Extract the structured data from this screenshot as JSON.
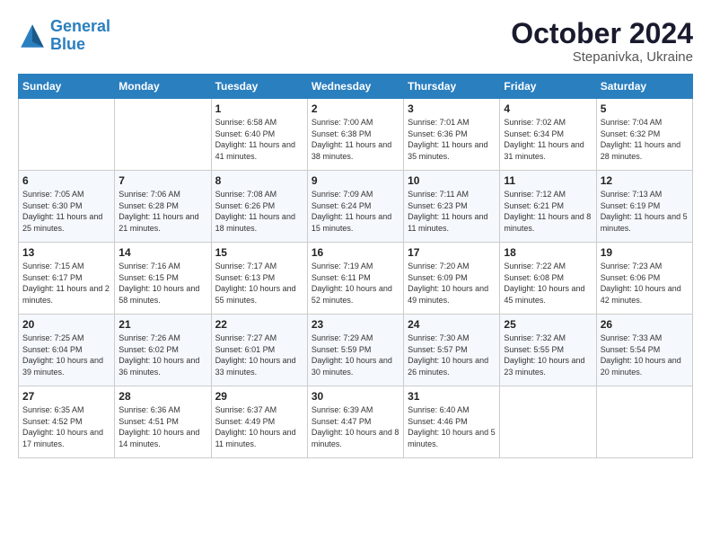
{
  "header": {
    "logo_line1": "General",
    "logo_line2": "Blue",
    "month": "October 2024",
    "location": "Stepanivka, Ukraine"
  },
  "weekdays": [
    "Sunday",
    "Monday",
    "Tuesday",
    "Wednesday",
    "Thursday",
    "Friday",
    "Saturday"
  ],
  "weeks": [
    [
      {
        "day": "",
        "info": ""
      },
      {
        "day": "",
        "info": ""
      },
      {
        "day": "1",
        "info": "Sunrise: 6:58 AM\nSunset: 6:40 PM\nDaylight: 11 hours and 41 minutes."
      },
      {
        "day": "2",
        "info": "Sunrise: 7:00 AM\nSunset: 6:38 PM\nDaylight: 11 hours and 38 minutes."
      },
      {
        "day": "3",
        "info": "Sunrise: 7:01 AM\nSunset: 6:36 PM\nDaylight: 11 hours and 35 minutes."
      },
      {
        "day": "4",
        "info": "Sunrise: 7:02 AM\nSunset: 6:34 PM\nDaylight: 11 hours and 31 minutes."
      },
      {
        "day": "5",
        "info": "Sunrise: 7:04 AM\nSunset: 6:32 PM\nDaylight: 11 hours and 28 minutes."
      }
    ],
    [
      {
        "day": "6",
        "info": "Sunrise: 7:05 AM\nSunset: 6:30 PM\nDaylight: 11 hours and 25 minutes."
      },
      {
        "day": "7",
        "info": "Sunrise: 7:06 AM\nSunset: 6:28 PM\nDaylight: 11 hours and 21 minutes."
      },
      {
        "day": "8",
        "info": "Sunrise: 7:08 AM\nSunset: 6:26 PM\nDaylight: 11 hours and 18 minutes."
      },
      {
        "day": "9",
        "info": "Sunrise: 7:09 AM\nSunset: 6:24 PM\nDaylight: 11 hours and 15 minutes."
      },
      {
        "day": "10",
        "info": "Sunrise: 7:11 AM\nSunset: 6:23 PM\nDaylight: 11 hours and 11 minutes."
      },
      {
        "day": "11",
        "info": "Sunrise: 7:12 AM\nSunset: 6:21 PM\nDaylight: 11 hours and 8 minutes."
      },
      {
        "day": "12",
        "info": "Sunrise: 7:13 AM\nSunset: 6:19 PM\nDaylight: 11 hours and 5 minutes."
      }
    ],
    [
      {
        "day": "13",
        "info": "Sunrise: 7:15 AM\nSunset: 6:17 PM\nDaylight: 11 hours and 2 minutes."
      },
      {
        "day": "14",
        "info": "Sunrise: 7:16 AM\nSunset: 6:15 PM\nDaylight: 10 hours and 58 minutes."
      },
      {
        "day": "15",
        "info": "Sunrise: 7:17 AM\nSunset: 6:13 PM\nDaylight: 10 hours and 55 minutes."
      },
      {
        "day": "16",
        "info": "Sunrise: 7:19 AM\nSunset: 6:11 PM\nDaylight: 10 hours and 52 minutes."
      },
      {
        "day": "17",
        "info": "Sunrise: 7:20 AM\nSunset: 6:09 PM\nDaylight: 10 hours and 49 minutes."
      },
      {
        "day": "18",
        "info": "Sunrise: 7:22 AM\nSunset: 6:08 PM\nDaylight: 10 hours and 45 minutes."
      },
      {
        "day": "19",
        "info": "Sunrise: 7:23 AM\nSunset: 6:06 PM\nDaylight: 10 hours and 42 minutes."
      }
    ],
    [
      {
        "day": "20",
        "info": "Sunrise: 7:25 AM\nSunset: 6:04 PM\nDaylight: 10 hours and 39 minutes."
      },
      {
        "day": "21",
        "info": "Sunrise: 7:26 AM\nSunset: 6:02 PM\nDaylight: 10 hours and 36 minutes."
      },
      {
        "day": "22",
        "info": "Sunrise: 7:27 AM\nSunset: 6:01 PM\nDaylight: 10 hours and 33 minutes."
      },
      {
        "day": "23",
        "info": "Sunrise: 7:29 AM\nSunset: 5:59 PM\nDaylight: 10 hours and 30 minutes."
      },
      {
        "day": "24",
        "info": "Sunrise: 7:30 AM\nSunset: 5:57 PM\nDaylight: 10 hours and 26 minutes."
      },
      {
        "day": "25",
        "info": "Sunrise: 7:32 AM\nSunset: 5:55 PM\nDaylight: 10 hours and 23 minutes."
      },
      {
        "day": "26",
        "info": "Sunrise: 7:33 AM\nSunset: 5:54 PM\nDaylight: 10 hours and 20 minutes."
      }
    ],
    [
      {
        "day": "27",
        "info": "Sunrise: 6:35 AM\nSunset: 4:52 PM\nDaylight: 10 hours and 17 minutes."
      },
      {
        "day": "28",
        "info": "Sunrise: 6:36 AM\nSunset: 4:51 PM\nDaylight: 10 hours and 14 minutes."
      },
      {
        "day": "29",
        "info": "Sunrise: 6:37 AM\nSunset: 4:49 PM\nDaylight: 10 hours and 11 minutes."
      },
      {
        "day": "30",
        "info": "Sunrise: 6:39 AM\nSunset: 4:47 PM\nDaylight: 10 hours and 8 minutes."
      },
      {
        "day": "31",
        "info": "Sunrise: 6:40 AM\nSunset: 4:46 PM\nDaylight: 10 hours and 5 minutes."
      },
      {
        "day": "",
        "info": ""
      },
      {
        "day": "",
        "info": ""
      }
    ]
  ]
}
